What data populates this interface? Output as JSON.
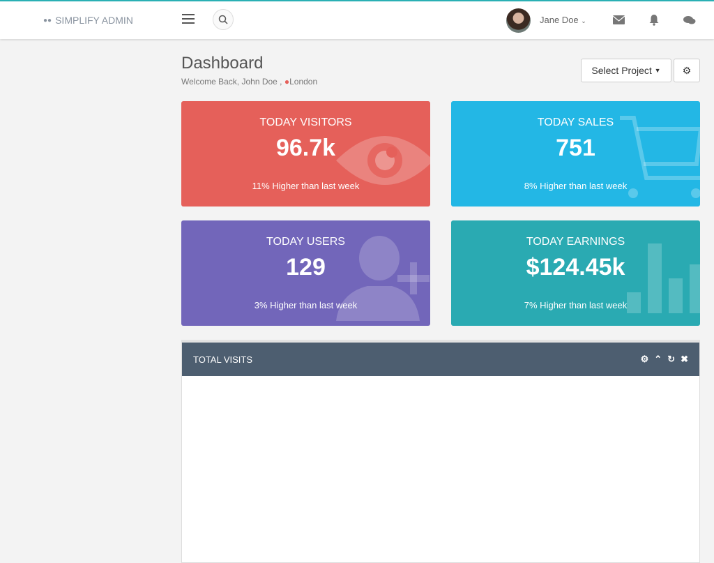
{
  "header": {
    "brand": "SIMPLIFY ADMIN",
    "user_name": "Jane Doe",
    "accent": "#2ab0b4"
  },
  "page": {
    "title": "Dashboard",
    "welcome": "Welcome Back, John Doe ,",
    "location": "London",
    "select_project": "Select Project"
  },
  "cards": [
    {
      "label": "TODAY VISITORS",
      "value": "96.7k",
      "note": "11% Higher than last week",
      "color": "#e5605a",
      "icon": "eye-icon"
    },
    {
      "label": "TODAY SALES",
      "value": "751",
      "note": "8% Higher than last week",
      "color": "#23b7e5",
      "icon": "cart-icon"
    },
    {
      "label": "TODAY USERS",
      "value": "129",
      "note": "3% Higher than last week",
      "color": "#7266ba",
      "icon": "user-plus-icon"
    },
    {
      "label": "TODAY EARNINGS",
      "value": "$124.45k",
      "note": "7% Higher than last week",
      "color": "#2aaab2",
      "icon": "bar-chart-icon"
    }
  ],
  "panel": {
    "title": "TOTAL VISITS"
  }
}
